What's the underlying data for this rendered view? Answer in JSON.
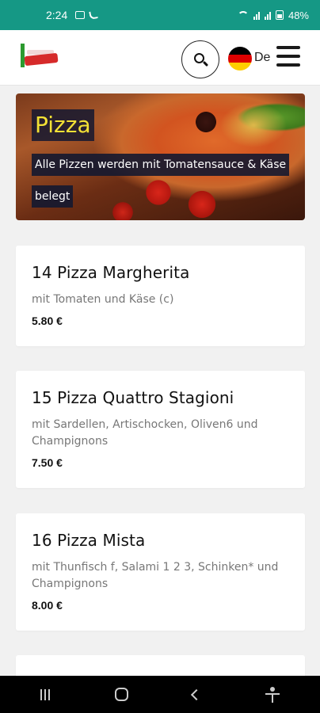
{
  "status_bar": {
    "time": "2:24",
    "battery": "48%"
  },
  "header": {
    "language": "De",
    "flag_colors": [
      "#000000",
      "#dd0000",
      "#ffce00"
    ]
  },
  "banner": {
    "title": "Pizza",
    "text": "Alle Pizzen werden mit Tomatensauce & Käse belegt"
  },
  "menu_items": [
    {
      "title": "14 Pizza Margherita",
      "description": "mit Tomaten und Käse (c)",
      "price": "5.80 €"
    },
    {
      "title": "15 Pizza Quattro Stagioni",
      "description": "mit Sardellen, Artischocken, Oliven6 und Champignons",
      "price": "7.50 €"
    },
    {
      "title": "16 Pizza Mista",
      "description": "mit Thunfisch f, Salami 1 2 3, Schinken* und Champignons",
      "price": "8.00 €"
    }
  ],
  "colors": {
    "status_bar": "#159885",
    "banner_title": "#f3e135",
    "label_bg": "#141830"
  }
}
